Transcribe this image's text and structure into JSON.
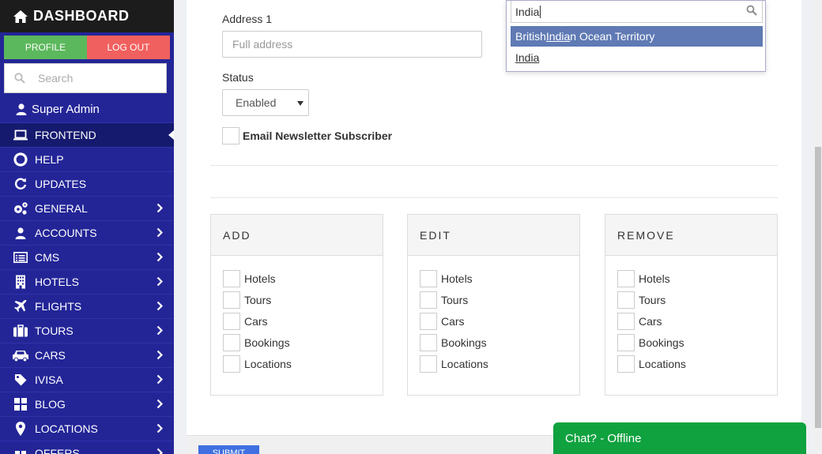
{
  "sidebar": {
    "brand": "DASHBOARD",
    "profile_label": "PROFILE",
    "logout_label": "LOG OUT",
    "search_placeholder": "Search",
    "user": "Super Admin",
    "items": [
      {
        "label": "FRONTEND",
        "icon": "laptop-icon",
        "chevron": false,
        "active": true
      },
      {
        "label": "HELP",
        "icon": "life-ring-icon",
        "chevron": false
      },
      {
        "label": "UPDATES",
        "icon": "refresh-icon",
        "chevron": false
      },
      {
        "label": "GENERAL",
        "icon": "cogs-icon",
        "chevron": true
      },
      {
        "label": "ACCOUNTS",
        "icon": "user-icon",
        "chevron": true
      },
      {
        "label": "CMS",
        "icon": "list-alt-icon",
        "chevron": true
      },
      {
        "label": "HOTELS",
        "icon": "building-icon",
        "chevron": true
      },
      {
        "label": "FLIGHTS",
        "icon": "plane-icon",
        "chevron": true
      },
      {
        "label": "TOURS",
        "icon": "suitcase-icon",
        "chevron": true
      },
      {
        "label": "CARS",
        "icon": "car-icon",
        "chevron": true
      },
      {
        "label": "IVISA",
        "icon": "tag-icon",
        "chevron": true
      },
      {
        "label": "BLOG",
        "icon": "grid-icon",
        "chevron": true
      },
      {
        "label": "LOCATIONS",
        "icon": "map-marker-icon",
        "chevron": true
      },
      {
        "label": "OFFERS",
        "icon": "gift-icon",
        "chevron": true
      }
    ]
  },
  "form": {
    "address_label": "Address 1",
    "address_placeholder": "Full address",
    "status_label": "Status",
    "status_value": "Enabled",
    "newsletter_label": "Email Newsletter Subscriber"
  },
  "permissions": {
    "panels": [
      {
        "title": "ADD",
        "items": [
          "Hotels",
          "Tours",
          "Cars",
          "Bookings",
          "Locations"
        ]
      },
      {
        "title": "EDIT",
        "items": [
          "Hotels",
          "Tours",
          "Cars",
          "Bookings",
          "Locations"
        ]
      },
      {
        "title": "REMOVE",
        "items": [
          "Hotels",
          "Tours",
          "Cars",
          "Bookings",
          "Locations"
        ]
      }
    ]
  },
  "footer": {
    "submit_label": "SUBMIT"
  },
  "country_dropdown": {
    "query": "India",
    "options": [
      {
        "before": "British ",
        "match": "India",
        "after": "n Ocean Territory",
        "highlighted": true
      },
      {
        "before": "",
        "match": "India",
        "after": "",
        "highlighted": false
      }
    ]
  },
  "chat": {
    "label": "Chat? - Offline"
  },
  "colors": {
    "sidebar_bg": "#232597",
    "profile_btn": "#5cb85c",
    "logout_btn": "#f0605e",
    "chat_bg": "#0fa23f",
    "dropdown_highlight": "#5f7ab4",
    "submit_btn": "#3f6fe0"
  }
}
